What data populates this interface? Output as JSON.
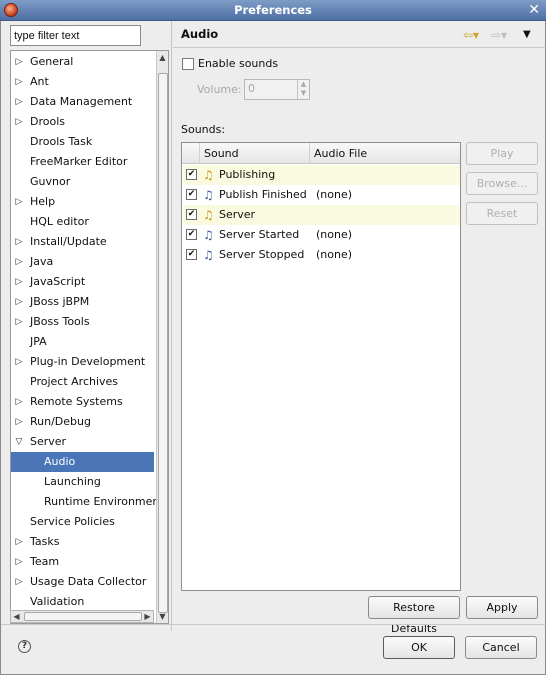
{
  "window": {
    "title": "Preferences"
  },
  "filter": {
    "placeholder": "type filter text"
  },
  "tree": [
    {
      "label": "General",
      "expander": "▷"
    },
    {
      "label": "Ant",
      "expander": "▷"
    },
    {
      "label": "Data Management",
      "expander": "▷"
    },
    {
      "label": "Drools",
      "expander": "▷"
    },
    {
      "label": "Drools Task",
      "expander": ""
    },
    {
      "label": "FreeMarker Editor",
      "expander": ""
    },
    {
      "label": "Guvnor",
      "expander": ""
    },
    {
      "label": "Help",
      "expander": "▷"
    },
    {
      "label": "HQL editor",
      "expander": ""
    },
    {
      "label": "Install/Update",
      "expander": "▷"
    },
    {
      "label": "Java",
      "expander": "▷"
    },
    {
      "label": "JavaScript",
      "expander": "▷"
    },
    {
      "label": "JBoss jBPM",
      "expander": "▷"
    },
    {
      "label": "JBoss Tools",
      "expander": "▷"
    },
    {
      "label": "JPA",
      "expander": ""
    },
    {
      "label": "Plug-in Development",
      "expander": "▷"
    },
    {
      "label": "Project Archives",
      "expander": ""
    },
    {
      "label": "Remote Systems",
      "expander": "▷"
    },
    {
      "label": "Run/Debug",
      "expander": "▷"
    },
    {
      "label": "Server",
      "expander": "▽"
    },
    {
      "label": "Audio",
      "expander": "",
      "selected": true
    },
    {
      "label": "Launching",
      "expander": ""
    },
    {
      "label": "Runtime Environment",
      "expander": ""
    },
    {
      "label": "Service Policies",
      "expander": ""
    },
    {
      "label": "Tasks",
      "expander": "▷"
    },
    {
      "label": "Team",
      "expander": "▷"
    },
    {
      "label": "Usage Data Collector",
      "expander": "▷"
    },
    {
      "label": "Validation",
      "expander": ""
    }
  ],
  "page": {
    "title": "Audio",
    "nav_back": "⇦▾",
    "nav_forward": "⇨▾",
    "nav_menu": "▼",
    "enable_sounds": {
      "label": "Enable sounds",
      "checked": false
    },
    "volume": {
      "label": "Volume:",
      "value": "0"
    },
    "sounds_label": "Sounds:",
    "columns": [
      "Sound",
      "Audio File"
    ],
    "rows": [
      {
        "sound": "Publishing",
        "audio_file": "",
        "checked": true,
        "category": true
      },
      {
        "sound": "Publish Finished",
        "audio_file": "(none)",
        "checked": true,
        "category": false
      },
      {
        "sound": "Server",
        "audio_file": "",
        "checked": true,
        "category": true
      },
      {
        "sound": "Server Started",
        "audio_file": "(none)",
        "checked": true,
        "category": false
      },
      {
        "sound": "Server Stopped",
        "audio_file": "(none)",
        "checked": true,
        "category": false
      }
    ],
    "buttons": {
      "play": "Play",
      "browse": "Browse...",
      "reset": "Reset"
    }
  },
  "footer": {
    "restore_defaults": "Restore Defaults",
    "apply": "Apply",
    "ok": "OK",
    "cancel": "Cancel",
    "help_icon": "?"
  },
  "colors": {
    "selection": "#4a76b8",
    "category_row": "#fafae0",
    "titlebar": "#5a7bb0"
  }
}
